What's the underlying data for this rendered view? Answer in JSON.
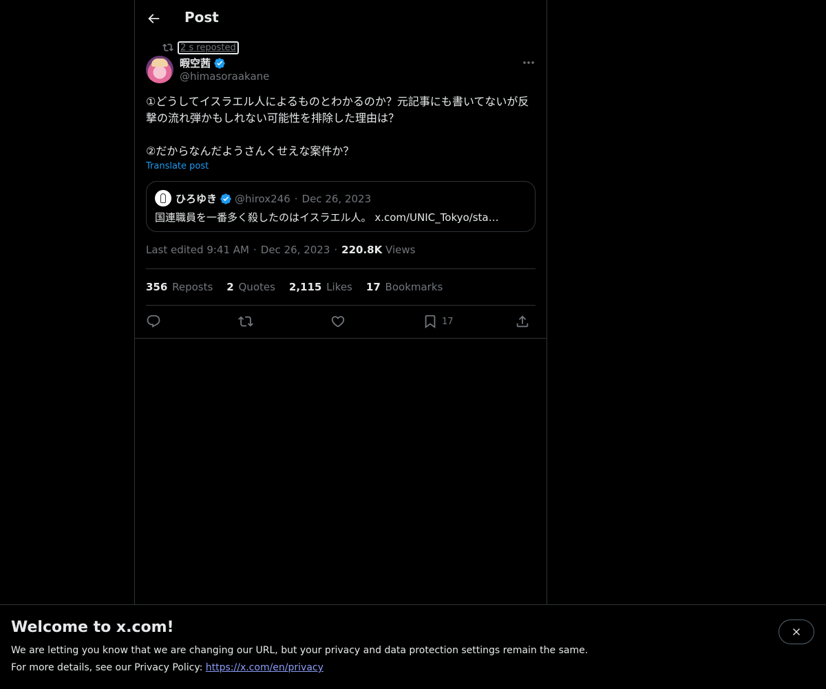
{
  "header": {
    "title": "Post"
  },
  "social_context": {
    "text": "2 s reposted"
  },
  "author": {
    "name": "暇空茜",
    "handle": "@himasoraakane"
  },
  "post": {
    "text": "①どうしてイスラエル人によるものとわかるのか？元記事にも書いてないが反撃の流れ弾かもしれない可能性を排除した理由は？\n\n②だからなんだようさんくせえな案件か？",
    "translate_label": "Translate post"
  },
  "quote": {
    "name": "ひろゆき",
    "handle": "@hirox246",
    "dot": "·",
    "date": "Dec 26, 2023",
    "text": "国連職員を一番多く殺したのはイスラエル人。 x.com/UNIC_Tokyo/sta…"
  },
  "meta": {
    "edited": "Last edited 9:41 AM",
    "sep": "·",
    "date": "Dec 26, 2023",
    "views_count": "220.8K",
    "views_label": "Views"
  },
  "stats": {
    "reposts_count": "356",
    "reposts_label": "Reposts",
    "quotes_count": "2",
    "quotes_label": "Quotes",
    "likes_count": "2,115",
    "likes_label": "Likes",
    "bookmarks_count": "17",
    "bookmarks_label": "Bookmarks"
  },
  "actions": {
    "reply_icon": "reply-icon",
    "repost_icon": "repost-icon",
    "like_icon": "heart-icon",
    "bookmark_icon": "bookmark-icon",
    "bookmark_count": "17",
    "share_icon": "share-icon"
  },
  "banner": {
    "title": "Welcome to x.com!",
    "line1": "We are letting you know that we are changing our URL, but your privacy and data protection settings remain the same.",
    "line2_prefix": "For more details, see our Privacy Policy: ",
    "link": "https://x.com/en/privacy"
  },
  "colors": {
    "accent": "#1d9bf0",
    "background": "#000000",
    "muted": "#71767b",
    "border": "#2f3336"
  }
}
